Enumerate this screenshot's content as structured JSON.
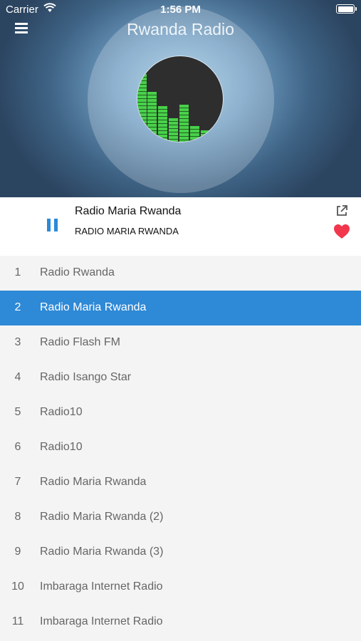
{
  "status_bar": {
    "carrier": "Carrier",
    "time": "1:56 PM"
  },
  "header": {
    "title": "Rwanda Radio"
  },
  "player": {
    "station_name": "Radio Maria Rwanda",
    "station_subtitle": "RADIO MARIA RWANDA",
    "state": "playing",
    "favorite": true
  },
  "colors": {
    "accent": "#2e89d6",
    "favorite": "#f2364c",
    "equalizer": "#49d14a"
  },
  "stations": [
    {
      "num": "1",
      "name": "Radio Rwanda"
    },
    {
      "num": "2",
      "name": "Radio Maria Rwanda",
      "active": true
    },
    {
      "num": "3",
      "name": "Radio Flash FM"
    },
    {
      "num": "4",
      "name": "Radio Isango Star"
    },
    {
      "num": "5",
      "name": "Radio10"
    },
    {
      "num": "6",
      "name": "Radio10"
    },
    {
      "num": "7",
      "name": "Radio Maria Rwanda"
    },
    {
      "num": "8",
      "name": "Radio Maria Rwanda (2)"
    },
    {
      "num": "9",
      "name": "Radio Maria Rwanda (3)"
    },
    {
      "num": "10",
      "name": "Imbaraga Internet Radio"
    },
    {
      "num": "11",
      "name": "Imbaraga Internet Radio"
    }
  ]
}
